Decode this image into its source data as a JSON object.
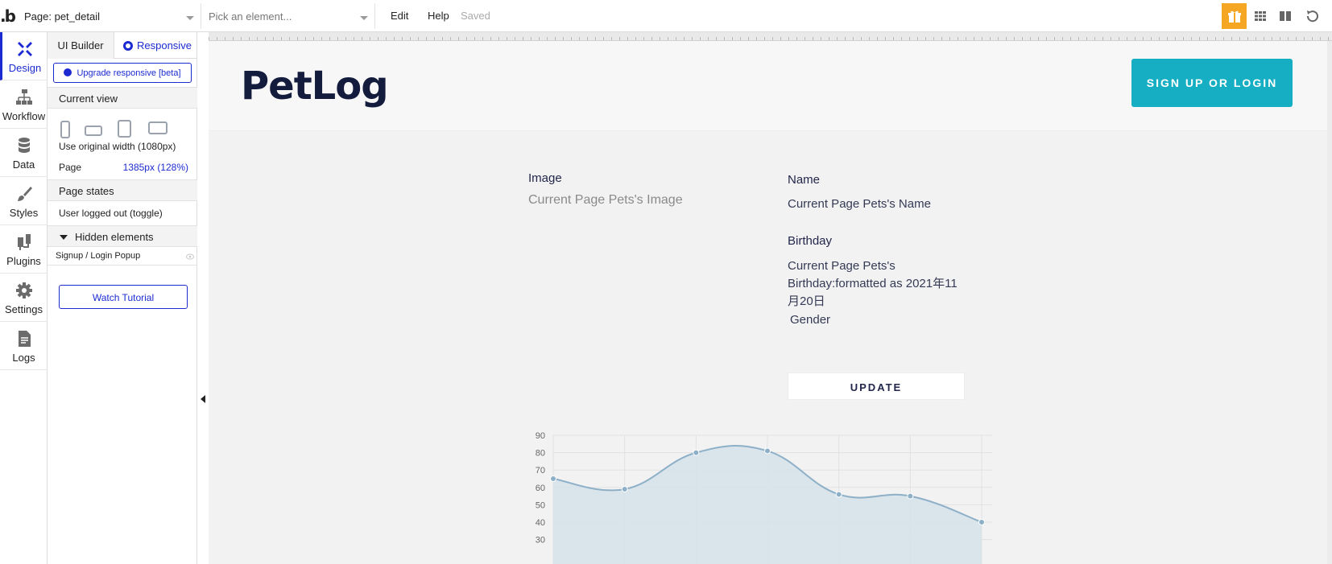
{
  "topbar": {
    "logo": ".b",
    "page_select": "Page: pet_detail",
    "element_select_placeholder": "Pick an element...",
    "menu": [
      "Edit",
      "Help"
    ],
    "saved_status": "Saved"
  },
  "rail": {
    "items": [
      {
        "label": "Design",
        "icon": "design-icon",
        "active": true
      },
      {
        "label": "Workflow",
        "icon": "workflow-icon"
      },
      {
        "label": "Data",
        "icon": "database-icon"
      },
      {
        "label": "Styles",
        "icon": "brush-icon"
      },
      {
        "label": "Plugins",
        "icon": "plug-icon"
      },
      {
        "label": "Settings",
        "icon": "gear-icon"
      },
      {
        "label": "Logs",
        "icon": "document-icon"
      }
    ]
  },
  "panel": {
    "tab_ui": "UI Builder",
    "tab_responsive": "Responsive",
    "upgrade_button": "Upgrade responsive [beta]",
    "current_view_header": "Current view",
    "original_width": "Use original width (1080px)",
    "page_label": "Page",
    "page_value": "1385px (128%)",
    "page_states_header": "Page states",
    "page_state_item": "User logged out (toggle)",
    "hidden_elements_header": "Hidden elements",
    "hidden_item": "Signup / Login Popup",
    "watch_tutorial": "Watch Tutorial"
  },
  "canvas": {
    "brand": "PetLog",
    "signup_button": "SIGN UP OR LOGIN",
    "image_label": "Image",
    "image_placeholder": "Current Page Pets's Image",
    "name_label": "Name",
    "name_value": "Current Page Pets's Name",
    "birthday_label": "Birthday",
    "birthday_line1": "Current Page Pets's",
    "birthday_line2": "Birthday:formatted as 2021年11",
    "birthday_line3": "月20日",
    "gender_label": "Gender",
    "update_button": "UPDATE"
  },
  "colors": {
    "accent": "#1c2bd1",
    "brand_navy": "#131c3c",
    "signup_teal": "#16aec3",
    "gift_orange": "#f5a623",
    "chart_line": "#8db0c8",
    "chart_fill": "#d6e2ea"
  },
  "chart_data": {
    "type": "area",
    "x": [
      0,
      1,
      2,
      3,
      4,
      5,
      6
    ],
    "values": [
      65,
      59,
      80,
      81,
      56,
      55,
      40
    ],
    "yticks": [
      90,
      80,
      70,
      60,
      50,
      40,
      30
    ],
    "ylim": [
      30,
      90
    ],
    "grid": true,
    "title": "",
    "xlabel": "",
    "ylabel": ""
  }
}
